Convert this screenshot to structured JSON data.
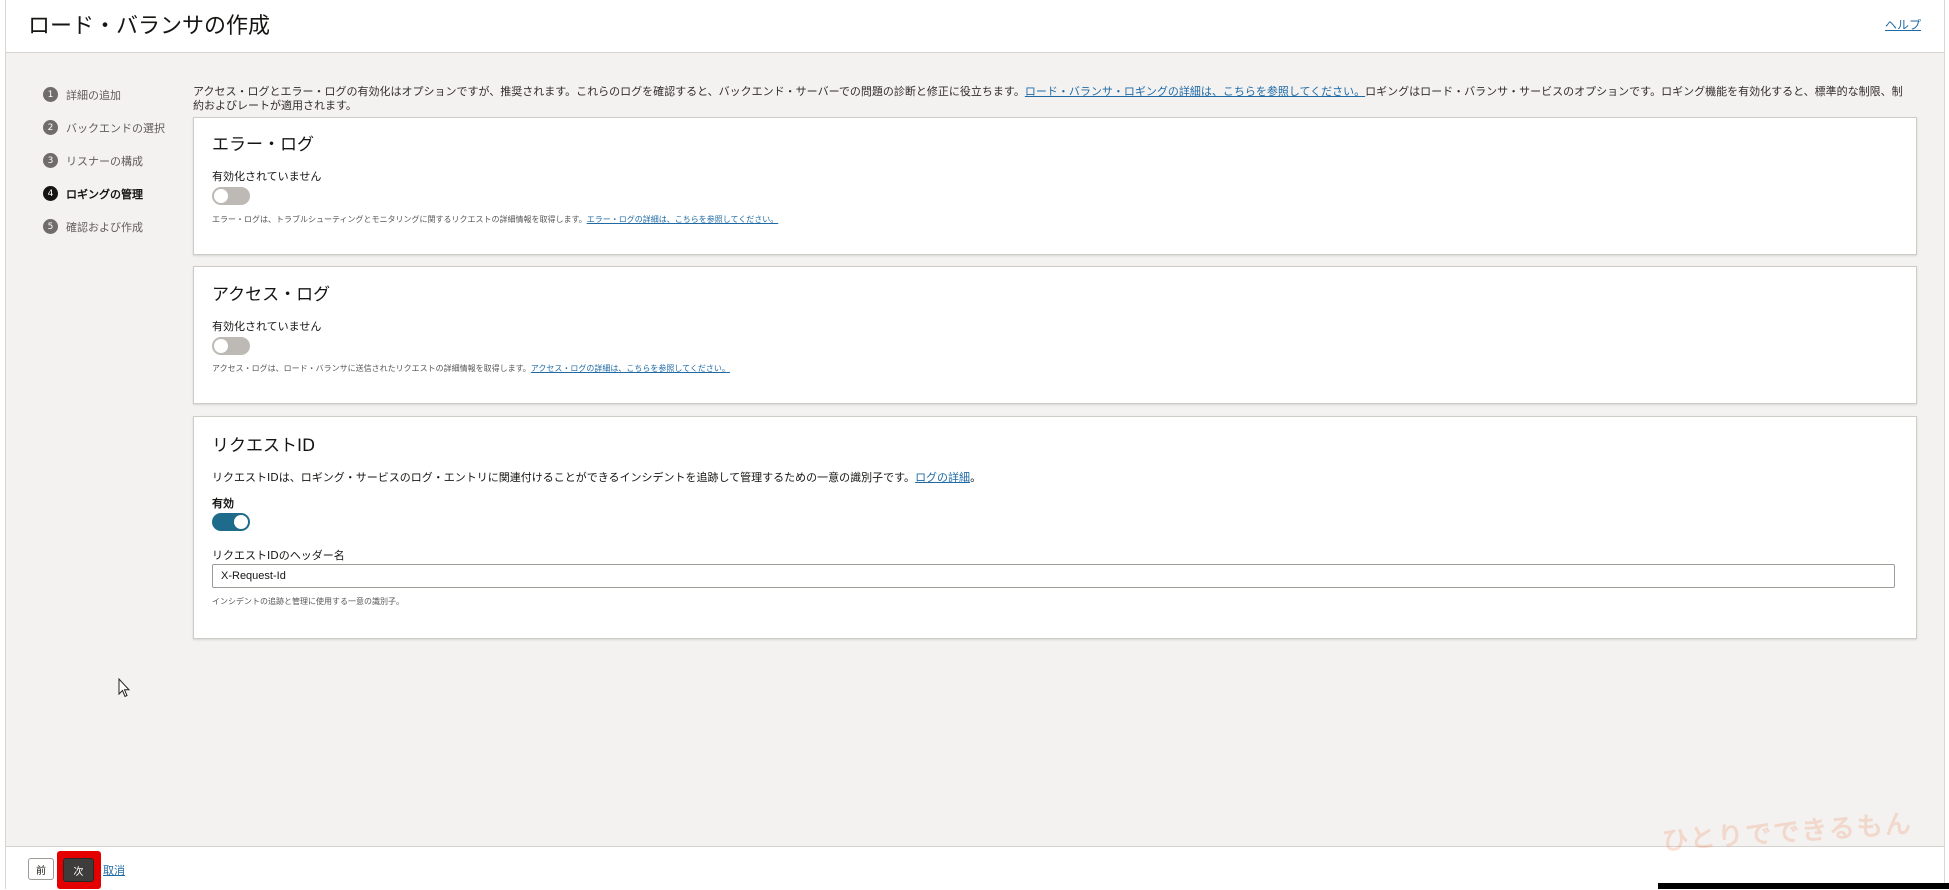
{
  "header": {
    "title": "ロード・バランサの作成",
    "help": "ヘルプ"
  },
  "steps": [
    {
      "num": "1",
      "label": "詳細の追加"
    },
    {
      "num": "2",
      "label": "バックエンドの選択"
    },
    {
      "num": "3",
      "label": "リスナーの構成"
    },
    {
      "num": "4",
      "label": "ロギングの管理"
    },
    {
      "num": "5",
      "label": "確認および作成"
    }
  ],
  "intro": {
    "text_before": "アクセス・ログとエラー・ログの有効化はオプションですが、推奨されます。これらのログを確認すると、バックエンド・サーバーでの問題の診断と修正に役立ちます。",
    "link": "ロード・バランサ・ロギングの詳細は、こちらを参照してください。",
    "text_after": "ロギングはロード・バランサ・サービスのオプションです。ロギング機能を有効化すると、標準的な制限、制約およびレートが適用されます。"
  },
  "error_log": {
    "title": "エラー・ログ",
    "status": "有効化されていません",
    "enabled": false,
    "description": "エラー・ログは、トラブルシューティングとモニタリングに関するリクエストの詳細情報を取得します。",
    "link": "エラー・ログの詳細は、こちらを参照してください。"
  },
  "access_log": {
    "title": "アクセス・ログ",
    "status": "有効化されていません",
    "enabled": false,
    "description": "アクセス・ログは、ロード・バランサに送信されたリクエストの詳細情報を取得します。",
    "link": "アクセス・ログの詳細は、こちらを参照してください。"
  },
  "request_id": {
    "title": "リクエストID",
    "description": "リクエストIDは、ロギング・サービスのログ・エントリに関連付けることができるインシデントを追跡して管理するための一意の識別子です。",
    "link": "ログの詳細",
    "link_suffix": "。",
    "status": "有効",
    "enabled": true,
    "header_label": "リクエストIDのヘッダー名",
    "header_value": "X-Request-Id",
    "hint": "インシデントの追跡と管理に使用する一意の識別子。"
  },
  "footer": {
    "prev": "前",
    "next": "次",
    "cancel": "取消"
  },
  "watermark": "ひとりでできるもん",
  "colors": {
    "accent": "#1e6b8c",
    "link": "#1f6aa5",
    "highlight": "#e50000"
  }
}
